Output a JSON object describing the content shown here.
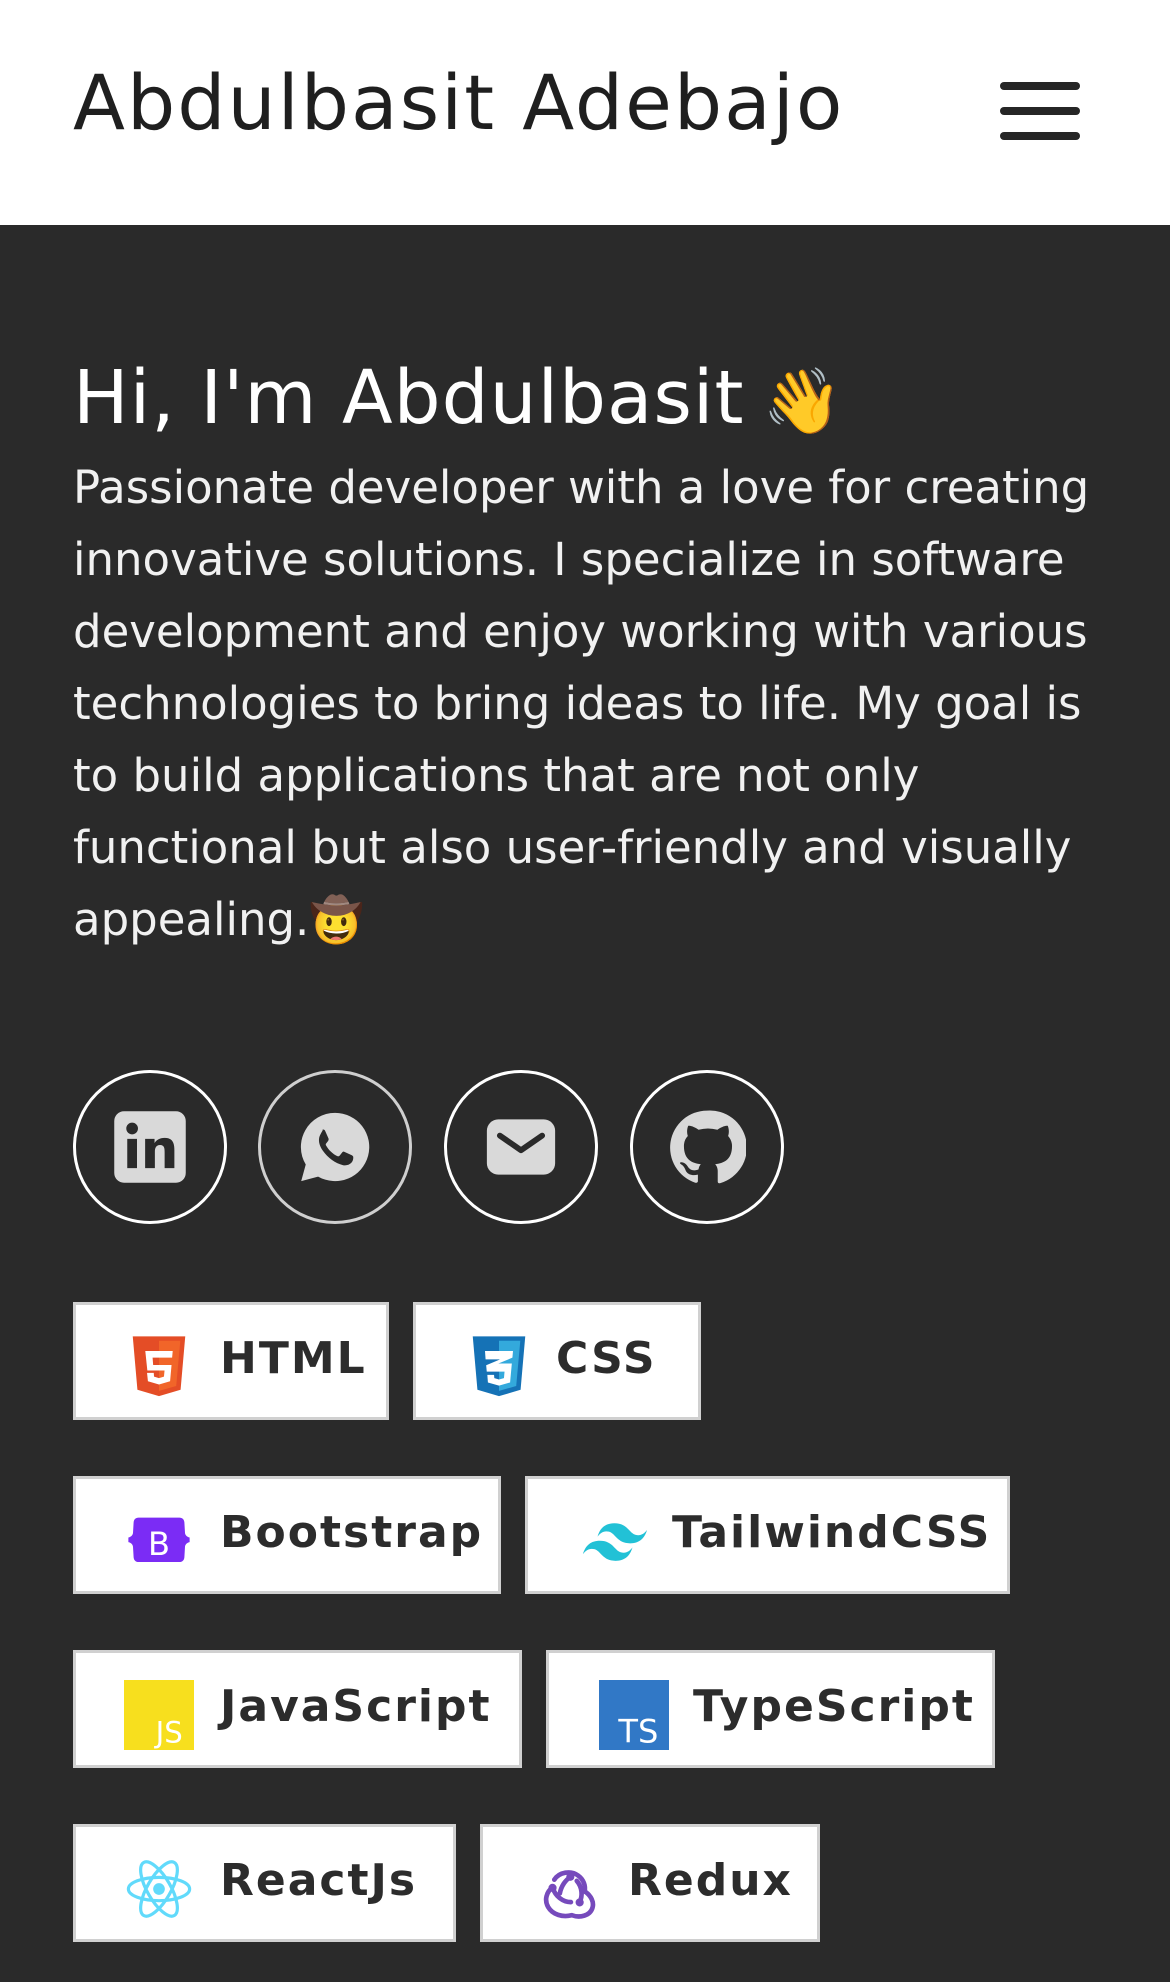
{
  "header": {
    "brand": "Abdulbasit Adebajo",
    "menu_icon": "hamburger-menu-icon"
  },
  "hero": {
    "title": "Hi, I'm Abdulbasit",
    "wave_emoji": "👋",
    "description": "Passionate developer with a love for creating innovative solutions. I specialize in software development and enjoy working with various technologies to bring ideas to life. My goal is to build applications that are not only functional but also user-friendly and visually appealing.",
    "end_emoji": "🤠"
  },
  "socials": [
    {
      "name": "LinkedIn",
      "icon": "linkedin-icon"
    },
    {
      "name": "WhatsApp",
      "icon": "whatsapp-icon"
    },
    {
      "name": "Email",
      "icon": "email-icon"
    },
    {
      "name": "GitHub",
      "icon": "github-icon"
    }
  ],
  "skills": [
    {
      "label": "HTML",
      "icon": "html5-icon",
      "color": "#e44d26"
    },
    {
      "label": "CSS",
      "icon": "css3-icon",
      "color": "#1572b6"
    },
    {
      "label": "Bootstrap",
      "icon": "bootstrap-icon",
      "color": "#7b2cf5"
    },
    {
      "label": "TailwindCSS",
      "icon": "tailwindcss-icon",
      "color": "#22c1d6"
    },
    {
      "label": "JavaScript",
      "icon": "javascript-icon",
      "color": "#f7df1e"
    },
    {
      "label": "TypeScript",
      "icon": "typescript-icon",
      "color": "#3178c6"
    },
    {
      "label": "ReactJs",
      "icon": "react-icon",
      "color": "#61dafb"
    },
    {
      "label": "Redux",
      "icon": "redux-icon",
      "color": "#764abc"
    }
  ],
  "colors": {
    "page_bg": "#2a2a2a",
    "header_bg": "#ffffff",
    "icon_gray": "#d9d9d9"
  }
}
